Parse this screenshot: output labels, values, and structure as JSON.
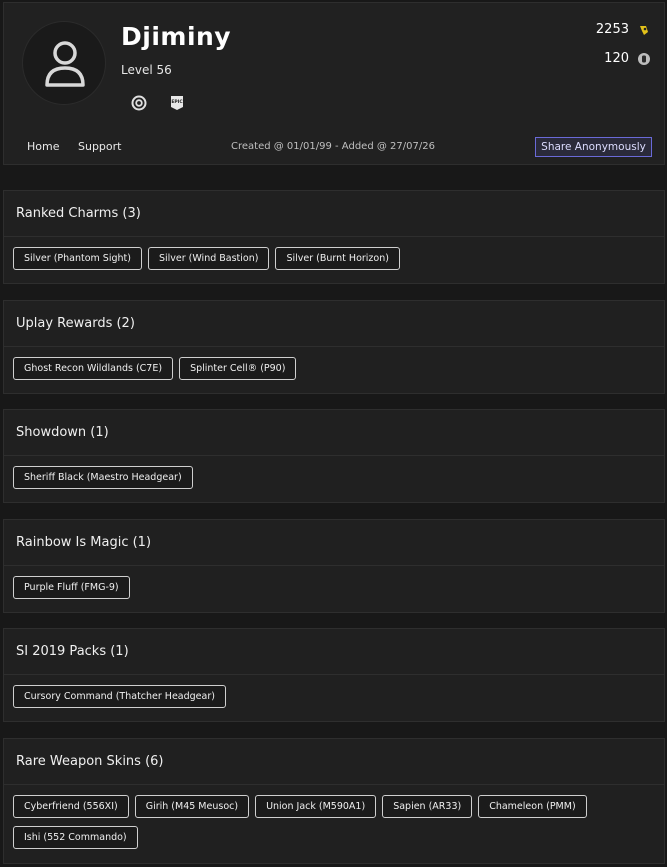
{
  "profile": {
    "username": "Djiminy",
    "level": "Level 56",
    "platforms": [
      {
        "icon": "uplay-icon"
      },
      {
        "icon": "epic-games-icon",
        "label": "EPIC"
      }
    ],
    "stats": [
      {
        "value": "2253",
        "icon": "renown-icon",
        "color": "#e3c21a"
      },
      {
        "value": "120",
        "icon": "r6-credits-icon",
        "color": "#bdbdbd"
      }
    ],
    "nav": [
      "Home",
      "Support"
    ],
    "created_text": "Created @ 01/01/99 - Added @ 27/07/26",
    "share_label": "Share Anonymously"
  },
  "sections": [
    {
      "title": "Ranked Charms (3)",
      "items": [
        "Silver (Phantom Sight)",
        "Silver (Wind Bastion)",
        "Silver (Burnt Horizon)"
      ]
    },
    {
      "title": "Uplay Rewards (2)",
      "items": [
        "Ghost Recon Wildlands (C7E)",
        "Splinter Cell® (P90)"
      ]
    },
    {
      "title": "Showdown (1)",
      "items": [
        "Sheriff Black (Maestro Headgear)"
      ]
    },
    {
      "title": "Rainbow Is Magic (1)",
      "items": [
        "Purple Fluff (FMG-9)"
      ]
    },
    {
      "title": "SI 2019 Packs (1)",
      "items": [
        "Cursory Command (Thatcher Headgear)"
      ]
    },
    {
      "title": "Rare Weapon Skins (6)",
      "items": [
        "Cyberfriend (556XI)",
        "Girih (M45 Meusoc)",
        "Union Jack (M590A1)",
        "Sapien (AR33)",
        "Chameleon (PMM)",
        "Ishi (552 Commando)"
      ]
    }
  ]
}
